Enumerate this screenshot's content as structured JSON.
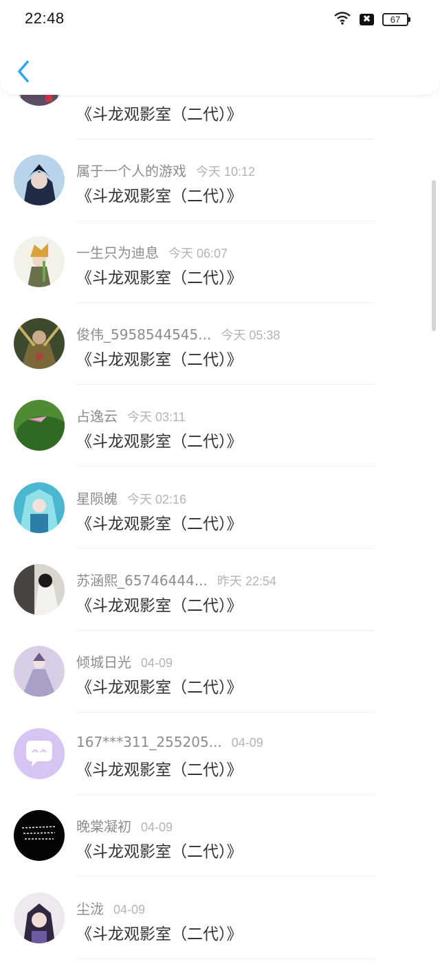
{
  "status_bar": {
    "time": "22:48",
    "battery": "67"
  },
  "header": {
    "back_icon": "chevron-left-icon"
  },
  "colors": {
    "accent": "#2aa4f4",
    "name": "#8c8c8c",
    "time": "#b4b4b4",
    "message": "#333333"
  },
  "items": [
    {
      "name": "",
      "time": "",
      "message": "《斗龙观影室（二代）》"
    },
    {
      "name": "属于一个人的游戏",
      "time": "今天 10:12",
      "message": "《斗龙观影室（二代）》"
    },
    {
      "name": "一生只为迪息",
      "time": "今天 06:07",
      "message": "《斗龙观影室（二代）》"
    },
    {
      "name": "俊伟_5958544545...",
      "time": "今天 05:38",
      "message": "《斗龙观影室（二代）》"
    },
    {
      "name": "占逸云",
      "time": "今天 03:11",
      "message": "《斗龙观影室（二代）》"
    },
    {
      "name": "星陨魄",
      "time": "今天 02:16",
      "message": "《斗龙观影室（二代）》"
    },
    {
      "name": "苏涵熙_65746444...",
      "time": "昨天 22:54",
      "message": "《斗龙观影室（二代）》"
    },
    {
      "name": "倾城日光",
      "time": "04-09",
      "message": "《斗龙观影室（二代）》"
    },
    {
      "name": "167***311_255205...",
      "time": "04-09",
      "message": "《斗龙观影室（二代）》"
    },
    {
      "name": "晚棠凝初",
      "time": "04-09",
      "message": "《斗龙观影室（二代）》"
    },
    {
      "name": "尘泷",
      "time": "04-09",
      "message": "《斗龙观影室（二代）》"
    }
  ]
}
